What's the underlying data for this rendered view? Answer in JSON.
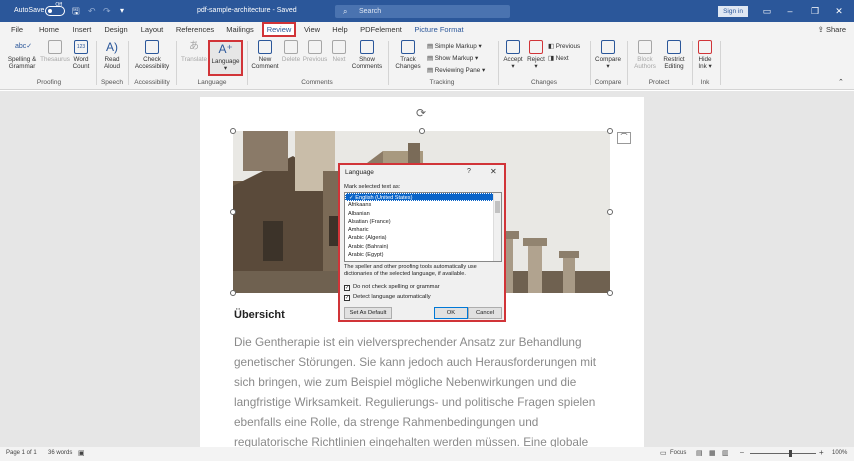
{
  "titlebar": {
    "autosave_label": "AutoSave",
    "autosave_state": "Off",
    "doc_title": "pdf-sample-architecture - Saved",
    "search_placeholder": "Search",
    "signin_label": "Sign in"
  },
  "menu": {
    "tabs": [
      "File",
      "Home",
      "Insert",
      "Design",
      "Layout",
      "References",
      "Mailings",
      "Review",
      "View",
      "Help",
      "PDFelement",
      "Picture Format"
    ],
    "active_tab": "Review",
    "share_label": "Share"
  },
  "ribbon": {
    "spelling": "Spelling &",
    "spelling2": "Grammar",
    "thesaurus": "Thesaurus",
    "word": "Word",
    "count": "Count",
    "read": "Read",
    "aloud": "Aloud",
    "check": "Check",
    "accessibility": "Accessibility",
    "translate": "Translate",
    "language": "Language",
    "new": "New",
    "comment": "Comment",
    "delete": "Delete",
    "previous": "Previous",
    "next": "Next",
    "show": "Show",
    "comments": "Comments",
    "track": "Track",
    "changes": "Changes",
    "simple_markup": "Simple Markup",
    "show_markup": "Show Markup",
    "reviewing_pane": "Reviewing Pane",
    "accept": "Accept",
    "reject": "Reject",
    "prev_change": "Previous",
    "next_change": "Next",
    "compare": "Compare",
    "block": "Block",
    "authors": "Authors",
    "restrict": "Restrict",
    "editing": "Editing",
    "hide": "Hide",
    "ink": "Ink",
    "groups": {
      "proofing": "Proofing",
      "speech": "Speech",
      "accessibility": "Accessibility",
      "language": "Language",
      "comments": "Comments",
      "tracking": "Tracking",
      "changes": "Changes",
      "compare": "Compare",
      "protect": "Protect",
      "ink": "Ink"
    }
  },
  "document": {
    "heading": "Übersicht",
    "lines": [
      "Die Gentherapie ist ein vielversprechender Ansatz zur Behandlung",
      "genetischer Störungen. Sie kann jedoch auch Herausforderungen mit",
      "sich bringen, wie zum Beispiel mögliche Nebenwirkungen und die",
      "langfristige Wirksamkeit. Regulierungs- und politische Fragen spielen",
      "ebenfalls eine Rolle, da strenge Rahmenbedingungen und",
      "regulatorische Richtlinien eingehalten werden müssen. Eine globale"
    ]
  },
  "dialog": {
    "title": "Language",
    "help": "?",
    "close": "✕",
    "mark_label": "Mark selected text as:",
    "languages": [
      "English (United States)",
      "Afrikaans",
      "Albanian",
      "Alsatian (France)",
      "Amharic",
      "Arabic (Algeria)",
      "Arabic (Bahrain)",
      "Arabic (Egypt)"
    ],
    "note": "The speller and other proofing tools automatically use dictionaries of the selected language, if available.",
    "chk_spelling": "Do not check spelling or grammar",
    "chk_detect": "Detect language automatically",
    "set_default": "Set As Default",
    "ok": "OK",
    "cancel": "Cancel"
  },
  "status": {
    "page": "Page 1 of 1",
    "words": "36 words",
    "focus": "Focus",
    "zoom": "100%"
  },
  "colors": {
    "brand": "#2b579a",
    "highlight": "#d13438"
  }
}
